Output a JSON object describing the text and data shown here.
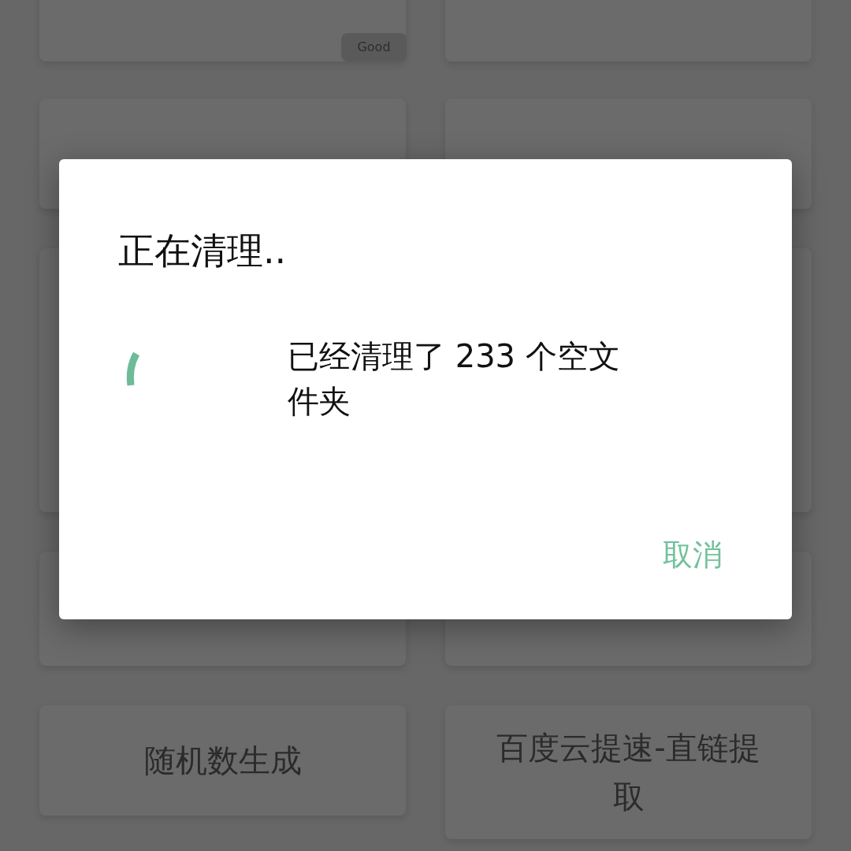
{
  "cards": [
    {
      "label": "随机数生成"
    },
    {
      "label": "百度云提速-直链提取"
    }
  ],
  "tooltip": {
    "text": "Good"
  },
  "dialog": {
    "title": "正在清理..",
    "message": "已经清理了 233 个空文件夹",
    "buttons": [
      "取消"
    ]
  }
}
